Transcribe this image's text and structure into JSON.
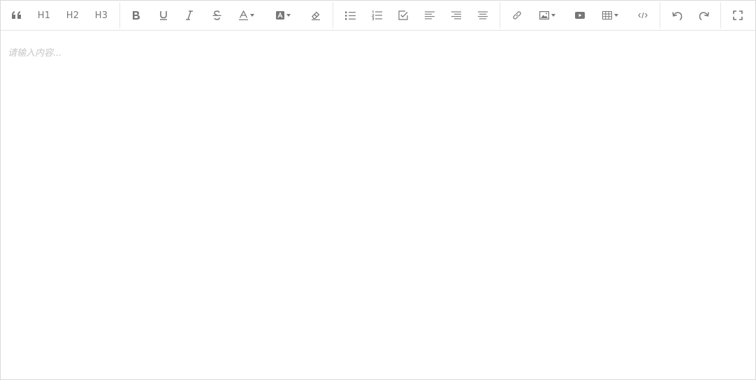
{
  "toolbar": {
    "heading_buttons": [
      "H1",
      "H2",
      "H3"
    ]
  },
  "editor": {
    "placeholder": "请输入内容..."
  },
  "icons": {
    "quote": "quote-icon",
    "bold": "bold-icon",
    "underline": "underline-icon",
    "italic": "italic-icon",
    "strike": "strikethrough-icon",
    "font_color": "font-color-icon",
    "bg_color": "background-color-icon",
    "clear": "eraser-icon",
    "bullet": "bullet-list-icon",
    "ordered": "ordered-list-icon",
    "todo": "checkbox-icon",
    "align_left": "align-left-icon",
    "align_right": "align-right-icon",
    "align_justify": "align-justify-icon",
    "link": "link-icon",
    "image": "image-icon",
    "video": "video-icon",
    "table": "table-icon",
    "code": "code-icon",
    "undo": "undo-icon",
    "redo": "redo-icon",
    "fullscreen": "fullscreen-icon"
  },
  "colors": {
    "icon": "#777777",
    "border": "#d9d9d9",
    "placeholder": "#c6c6c6"
  }
}
